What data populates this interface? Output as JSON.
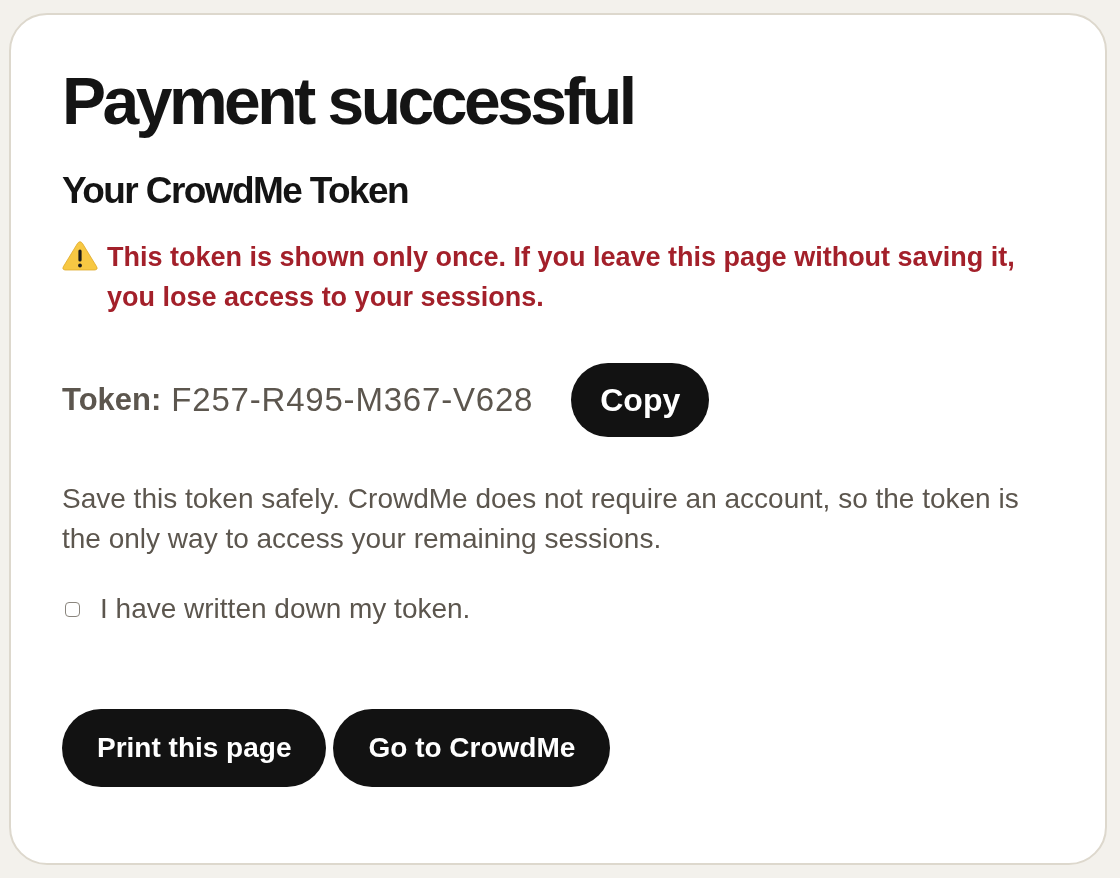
{
  "title": "Payment successful",
  "subtitle": "Your CrowdMe Token",
  "warning": {
    "text": "This token is shown only once. If you leave this page without saving it, you lose access to your sessions."
  },
  "token": {
    "label": "Token:",
    "value": "F257-R495-M367-V628",
    "copy_button": "Copy"
  },
  "note": "Save this token safely. CrowdMe does not require an account, so the token is the only way to access your remaining sessions.",
  "confirmation": {
    "label": "I have written down my token.",
    "checked": false
  },
  "buttons": [
    "Print this page",
    "Go to CrowdMe"
  ]
}
